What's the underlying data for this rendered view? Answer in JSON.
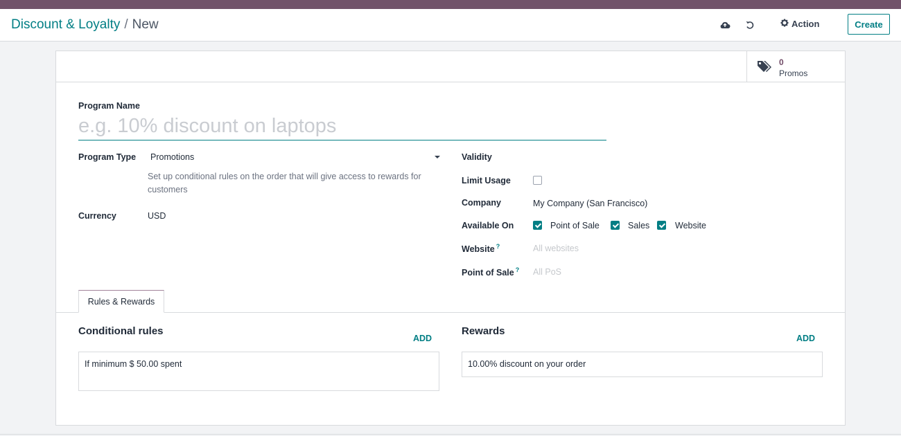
{
  "header": {
    "breadcrumb_parent": "Discount & Loyalty",
    "breadcrumb_separator": "/",
    "breadcrumb_current": "New",
    "action_label": "Action",
    "create_label": "Create"
  },
  "smart_button": {
    "count": "0",
    "label": "Promos",
    "icon": "tags-icon"
  },
  "form": {
    "program_name_label": "Program Name",
    "program_name_placeholder": "e.g. 10% discount on laptops",
    "program_type_label": "Program Type",
    "program_type_value": "Promotions",
    "program_type_description": "Set up conditional rules on the order that will give access to rewards for customers",
    "currency_label": "Currency",
    "currency_value": "USD",
    "validity_label": "Validity",
    "limit_usage_label": "Limit Usage",
    "limit_usage_checked": false,
    "company_label": "Company",
    "company_value": "My Company (San Francisco)",
    "available_on_label": "Available On",
    "available_on": [
      {
        "label": "Point of Sale",
        "checked": true
      },
      {
        "label": "Sales",
        "checked": true
      },
      {
        "label": "Website",
        "checked": true
      }
    ],
    "website_label": "Website",
    "website_help": "?",
    "website_placeholder": "All websites",
    "pos_label": "Point of Sale",
    "pos_help": "?",
    "pos_placeholder": "All PoS"
  },
  "tabs": [
    {
      "label": "Rules & Rewards",
      "active": true
    }
  ],
  "rules": {
    "title": "Conditional rules",
    "add_label": "ADD",
    "items": [
      "If minimum $ 50.00 spent"
    ]
  },
  "rewards": {
    "title": "Rewards",
    "add_label": "ADD",
    "items": [
      "10.00% discount on your order"
    ]
  },
  "colors": {
    "brand": "#71536a",
    "accent": "#017e84",
    "promo_count": "#714b67"
  }
}
